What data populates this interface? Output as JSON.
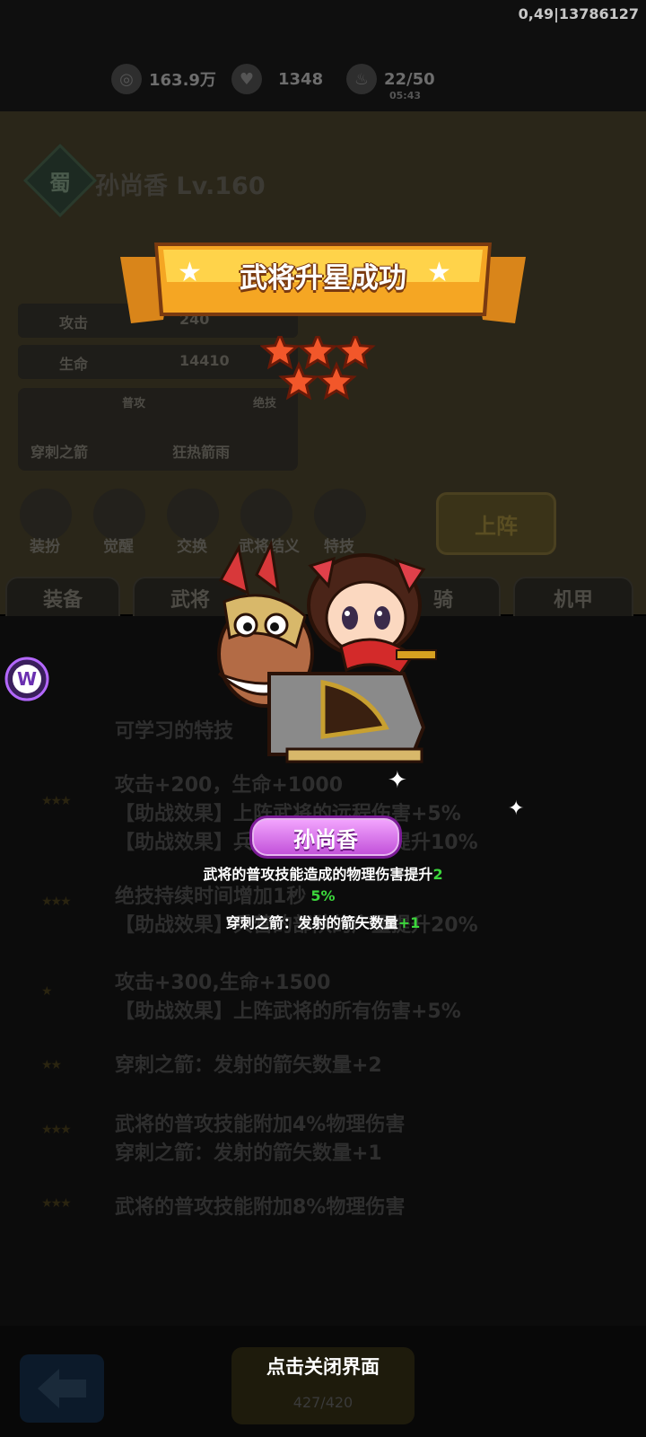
{
  "status": {
    "topright": "0,49|13786127"
  },
  "resources": [
    {
      "value": "163.9万",
      "sub": ""
    },
    {
      "value": "1348",
      "sub": ""
    },
    {
      "value": "22/50",
      "sub": "05:43"
    }
  ],
  "hero": {
    "faction": "蜀",
    "name": "孙尚香 Lv.160"
  },
  "stats": [
    {
      "label": "攻击",
      "value": "240"
    },
    {
      "label": "生命",
      "value": "14410"
    }
  ],
  "skills": [
    {
      "tag": "普攻",
      "name": "穿刺之箭"
    },
    {
      "tag": "绝技",
      "name": "狂热箭雨"
    }
  ],
  "functions": [
    "装扮",
    "觉醒",
    "交换",
    "武将结义",
    "特技"
  ],
  "deploy_label": "上阵",
  "tabs": [
    "装备",
    "武将",
    "骑",
    "机甲"
  ],
  "lower": {
    "section_title": "可学习的特技",
    "lines": [
      {
        "t": "攻击+200，生命+1000"
      },
      {
        "t": "【助战效果】上阵武将的远程伤害+5%"
      },
      {
        "t": "【助战效果】兵营的部队的产量提升10%"
      },
      {
        "t": "绝技持续时间增加1秒"
      },
      {
        "t": "【助战效果】兵营的部队的产量提升20%"
      },
      {
        "t": "攻击+300,生命+1500"
      },
      {
        "t": "【助战效果】上阵武将的所有伤害+5%"
      },
      {
        "t": "穿刺之箭：发射的箭矢数量+2"
      },
      {
        "t": "武将的普攻技能附加4%物理伤害"
      },
      {
        "t": "穿刺之箭：发射的箭矢数量+1"
      },
      {
        "t": "武将的普攻技能附加8%物理伤害"
      }
    ]
  },
  "upgrade": {
    "fragments": "427/420"
  },
  "overlay": {
    "banner": "武将升星成功",
    "hero_name": "孙尚香",
    "effect_line1_prefix": "武将的普攻技能造成的物理伤害提升",
    "effect_line1_value": "2",
    "effect_line2_value": "5%",
    "effect_line3_prefix": "穿刺之箭：发射的箭矢数量",
    "effect_line3_value": "+1",
    "close_hint": "点击关闭界面"
  },
  "colors": {
    "banner": "#f5a623",
    "highlight_green": "#3cd63c",
    "badge": "#c04ed8"
  },
  "star_count": 5
}
